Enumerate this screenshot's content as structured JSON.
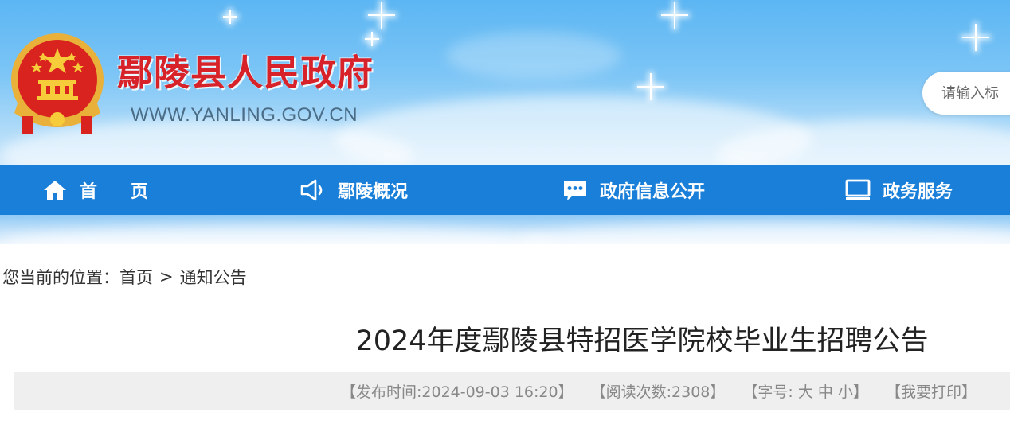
{
  "header": {
    "site_title": "鄢陵县人民政府",
    "site_url": "WWW.YANLING.GOV.CN",
    "emblem": "national-emblem",
    "search": {
      "placeholder": "请输入标"
    }
  },
  "nav": {
    "items": [
      {
        "label": "首页",
        "icon": "home-icon"
      },
      {
        "label": "鄢陵概况",
        "icon": "megaphone-icon"
      },
      {
        "label": "政府信息公开",
        "icon": "chat-bubble-icon"
      },
      {
        "label": "政务服务",
        "icon": "monitor-icon"
      }
    ],
    "color": "#1a7fd8"
  },
  "breadcrumb": {
    "prefix": "您当前的位置：",
    "items": [
      "首页",
      "通知公告"
    ],
    "separator": ">"
  },
  "article": {
    "title": "2024年度鄢陵县特招医学院校毕业生招聘公告",
    "meta": {
      "publish_label": "【发布时间:2024-09-03 16:20】",
      "views_label": "【阅读次数:2308】",
      "font_prefix": "【字号: ",
      "font_large": "大",
      "font_medium": "中",
      "font_small": "小",
      "font_suffix": "】",
      "print_label": "【我要打印】"
    }
  },
  "colors": {
    "title_red": "#d8222a",
    "nav_blue": "#1a7fd8",
    "meta_bg": "#efefef"
  }
}
